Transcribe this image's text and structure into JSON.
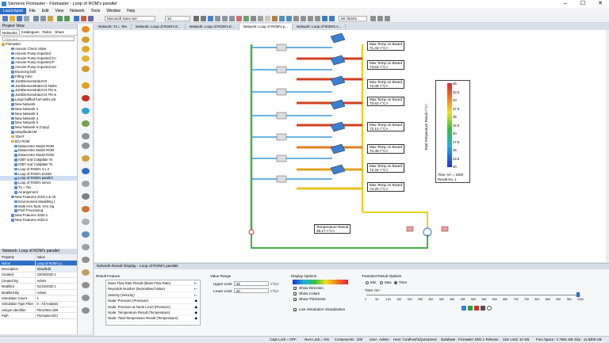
{
  "window": {
    "title": "Siemens Flomaster - Flomaster - Loop of ROM's parallel",
    "minimize": "–",
    "maximize": "☐",
    "close": "✕"
  },
  "menu": [
    "Launchpad",
    "File",
    "Edit",
    "View",
    "Network",
    "Tools",
    "Window",
    "Help"
  ],
  "toolbar": {
    "font": "Microsoft Sans Ser",
    "size": "10",
    "zoom": "69.7634%"
  },
  "project": {
    "title": "Project View",
    "tabs": [
      "Networks",
      "Catalogues",
      "Roles",
      "Share"
    ],
    "filter_placeholder": "Filter text",
    "tree": [
      "Flomaster",
      "Anexim Check Valve",
      "Anexim Pump Imported",
      "Anexim Pump Imported (Cr",
      "Anexim Pump Imported IF",
      "Anexim Pump Imported ser",
      "Bouncing ball",
      "Filling Time",
      "JointDemonstratorV2",
      "JointDemonstratorV2 Tanks",
      "JointDemonstratorV4 FM w",
      "JointDemonstratorV4 FM w",
      "Large baffled fuel tanks wit",
      "New Network",
      "New Network 2",
      "New Network 3",
      "New Network 4",
      "New Network 5",
      "New Network 5 (Copy)",
      "SimpifiedKCM",
      "TDHT",
      "BCI ROM",
      "Datacenter Model ROM",
      "Datacenter Model ROM",
      "Datacenter Model ROM",
      "IGBT and Coldplate To",
      "IGBT and Coldplate To",
      "Loop of ROM's 4 x 2",
      "Loop of ROM's Existin",
      "Loop of ROM's parallel",
      "Loop of ROM's series",
      "Tx = Tev",
      "Arrangement",
      "New Features 2019.1 & 20",
      "Environment Modelling (",
      "Multi Arm Tank: Arm Ing",
      "Post Processing",
      "New Features 2020.1",
      "New Features 2020.2"
    ]
  },
  "properties": {
    "title": "Network: Loop of ROM's parallel",
    "headers": [
      "Property",
      "Value"
    ],
    "rows": [
      [
        "Name",
        "Loop of ROM's p"
      ],
      [
        "Description",
        "View/Edit"
      ],
      [
        "Created",
        "23/09/2020 1"
      ],
      [
        "Created By",
        "Admin"
      ],
      [
        "Modified",
        "01/10/2020 1"
      ],
      [
        "Modified By",
        "Admin"
      ],
      [
        "Simulation Count",
        "1"
      ],
      [
        "Simulation Type Filter",
        "0 : All Analysis"
      ],
      [
        "Unique Identifier",
        "F8ce78ec-d05"
      ],
      [
        "Path",
        "Flomaster.BCI"
      ]
    ]
  },
  "doc_tabs": [
    "Network: Tx = Tev",
    "Network: Loop of ROM's E...",
    "Network: Loop of ROM's E...",
    "Network: Loop of ROM's p...",
    "Network: Loop of ROM's s..."
  ],
  "annotations": [
    {
      "label": "Max Temp on Board",
      "value": "71.43 <°C>"
    },
    {
      "label": "Max Temp on Board",
      "value": "73.63 <°C>"
    },
    {
      "label": "Max Temp on Board",
      "value": "72.09 <°C>"
    },
    {
      "label": "Max Temp on Board",
      "value": "73.63 <°C>"
    },
    {
      "label": "Max Temp on Board",
      "value": "72.14 <°C>"
    },
    {
      "label": "Max Temp on Board",
      "value": "73.49 <°C>"
    },
    {
      "label": "Max Temp on Board",
      "value": "72.34 <°C>"
    },
    {
      "label": "Max Temp on Board",
      "value": "73.20 <°C>"
    },
    {
      "label": "Temperature Result",
      "value": "38.17 <°C>"
    }
  ],
  "legend": {
    "title": "Total Temperature Result <°C>",
    "ticks": [
      "45",
      "42.5",
      "40",
      "37.5",
      "35",
      "32.5",
      "30",
      "27.5",
      "25",
      "22.5",
      "20"
    ],
    "time": "Time <s> = 1000",
    "result": "Result No. 1"
  },
  "result_panel": {
    "title": "Network Result Display - Loop of ROM's parallel",
    "result_feature_label": "Result Feature",
    "features": [
      "Mass Flow Rate Result (Mass Flow Rate)",
      "Reynolds Number (Normalised Value)",
      "Velocity (Velocity)",
      "Node: Pressure (Pressure)",
      "Node: Pressure at Node Level (Pressure)",
      "Node: Temperature Result (Temperature)",
      "Node: Total Temperature Result (Temperature)"
    ],
    "value_range_label": "Value Range",
    "upper_label": "Upper Limit",
    "upper_value": "45",
    "lower_label": "Lower Limit",
    "lower_value": "20",
    "unit": "<°C>",
    "display_options_label": "Display Options",
    "show_direction": "Show Direction",
    "show_colors": "Show Colors",
    "show_thickness": "Show Thickness",
    "live_sim": "Live Simulation Visualization",
    "transient_label": "Transient Result Options",
    "radio_min": "Min",
    "radio_max": "Max",
    "radio_time": "Time",
    "time_label": "Time <s>",
    "time_ticks": [
      "0",
      "50",
      "100",
      "150",
      "200",
      "250",
      "300",
      "350",
      "400",
      "450",
      "500",
      "550",
      "600",
      "650",
      "700",
      "750",
      "800",
      "850",
      "900",
      "950",
      "1000"
    ]
  },
  "status": [
    "Caps Lock = OFF",
    "Num Lock = ON",
    "Components : 100",
    "User : Admin",
    "Host : localhost\\SQLExpress",
    "Database : Flomaster 2021.1 Release",
    "Size Limit: 10 GB",
    "Free Space : 1.7691 GB",
    "Size : 11.8306 GB"
  ]
}
